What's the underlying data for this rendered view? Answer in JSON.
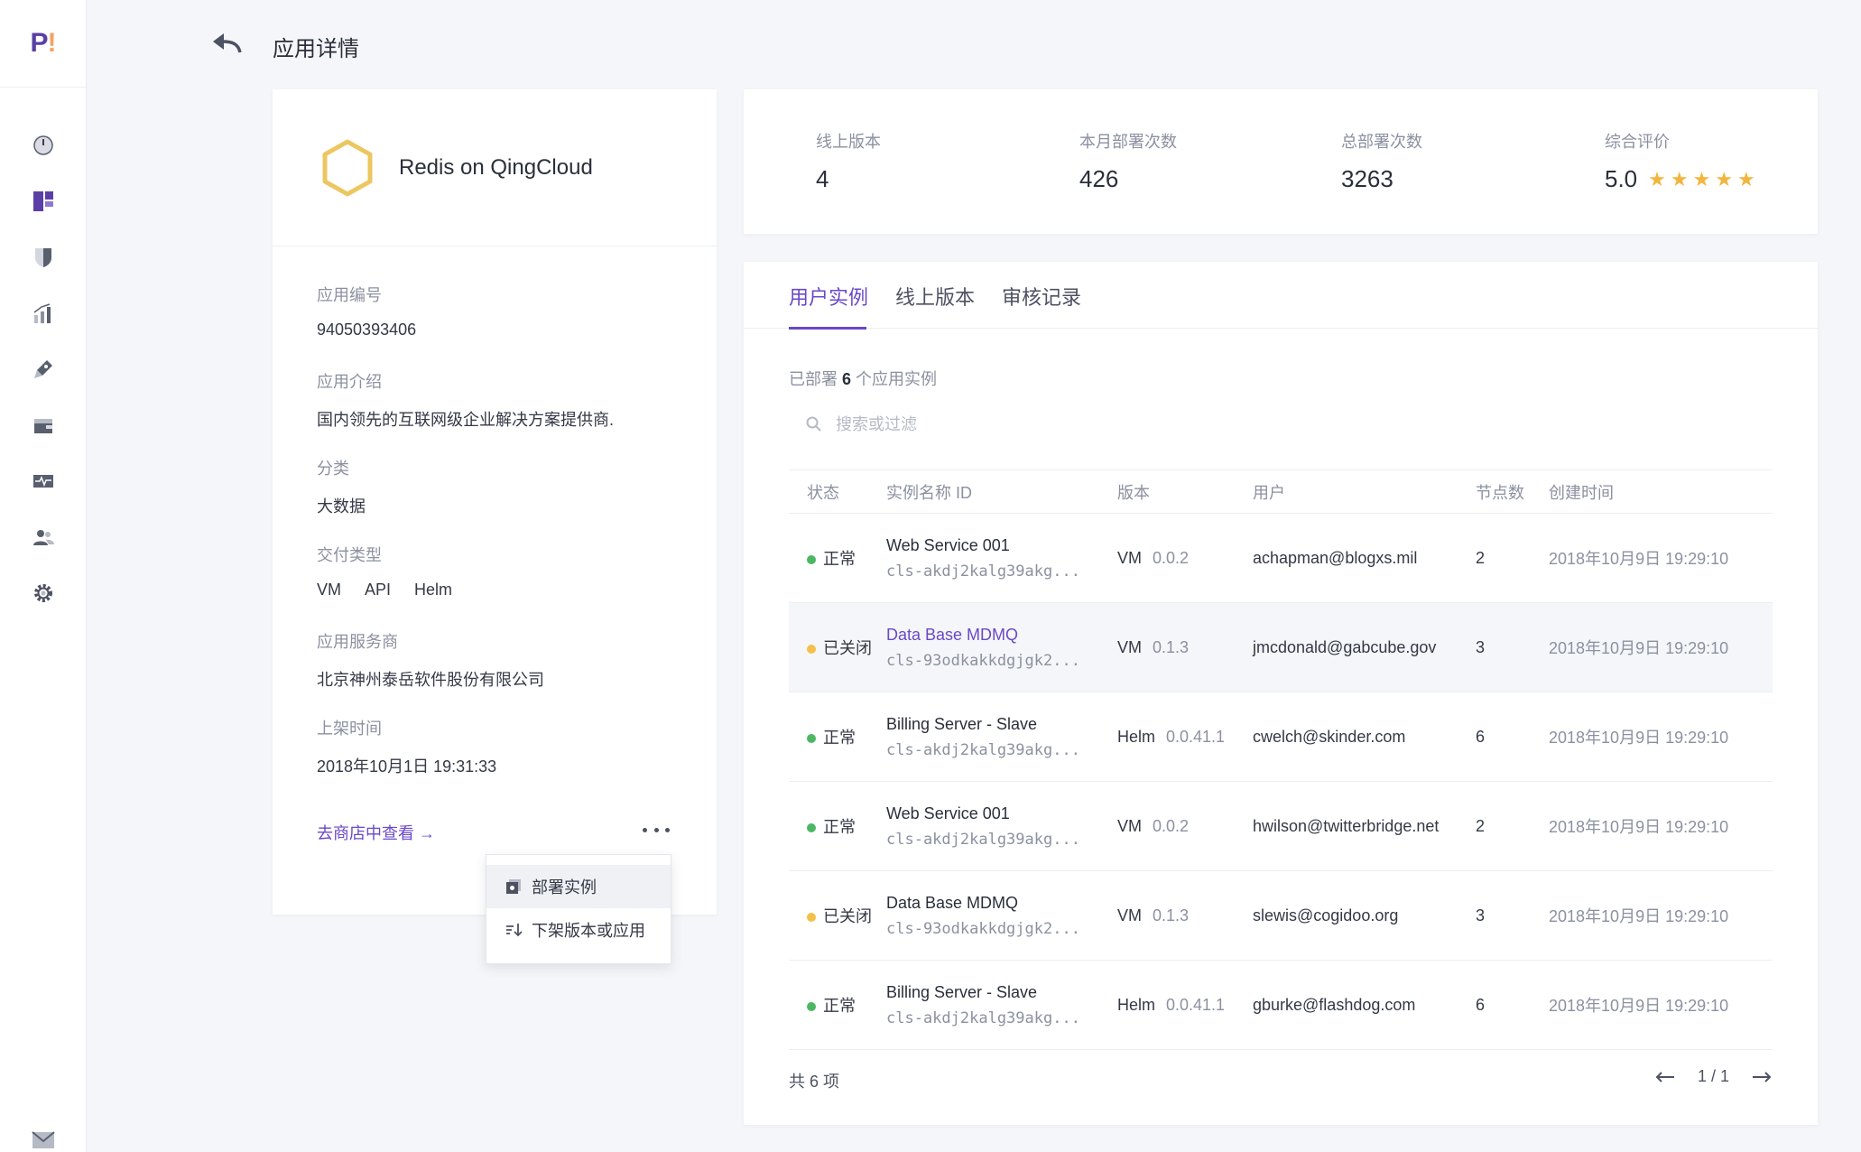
{
  "logo": {
    "text": "P",
    "mark": "!"
  },
  "nav": [
    "dashboard-icon",
    "apps-icon",
    "shield-icon",
    "chart-icon",
    "rocket-icon",
    "wallet-icon",
    "monitor-icon",
    "users-icon",
    "settings-icon"
  ],
  "header": {
    "title": "应用详情"
  },
  "app": {
    "name": "Redis on QingCloud",
    "fields": {
      "id_label": "应用编号",
      "id_value": "94050393406",
      "intro_label": "应用介绍",
      "intro_value": "国内领先的互联网级企业解决方案提供商.",
      "category_label": "分类",
      "category_value": "大数据",
      "delivery_label": "交付类型",
      "delivery_tags": [
        "VM",
        "API",
        "Helm"
      ],
      "vendor_label": "应用服务商",
      "vendor_value": "北京神州泰岳软件股份有限公司",
      "release_label": "上架时间",
      "release_value": "2018年10月1日 19:31:33"
    },
    "store_link": "去商店中查看 →"
  },
  "menu": {
    "deploy": "部署实例",
    "unpublish": "下架版本或应用"
  },
  "stats": {
    "online_label": "线上版本",
    "online_value": "4",
    "month_label": "本月部署次数",
    "month_value": "426",
    "total_label": "总部署次数",
    "total_value": "3263",
    "rating_label": "综合评价",
    "rating_value": "5.0",
    "stars": "★★★★★"
  },
  "tabs": [
    "用户实例",
    "线上版本",
    "审核记录"
  ],
  "summary": {
    "prefix": "已部署",
    "count": "6",
    "suffix": "个应用实例"
  },
  "search": {
    "placeholder": "搜索或过滤"
  },
  "colors": {
    "accent": "#6a48c7",
    "ok": "#4cb762",
    "closed": "#f5c04a"
  },
  "table": {
    "headers": [
      "状态",
      "实例名称 ID",
      "版本",
      "用户",
      "节点数",
      "创建时间"
    ],
    "rows": [
      {
        "status": "正常",
        "name": "Web Service 001",
        "id": "cls-akdj2kalg39akg...",
        "type": "VM",
        "version": "0.0.2",
        "user": "achapman@blogxs.mil",
        "nodes": "2",
        "time": "2018年10月9日 19:29:10"
      },
      {
        "status": "已关闭",
        "name": "Data Base MDMQ",
        "id": "cls-93odkakkdgjgk2...",
        "type": "VM",
        "version": "0.1.3",
        "user": "jmcdonald@gabcube.gov",
        "nodes": "3",
        "time": "2018年10月9日 19:29:10"
      },
      {
        "status": "正常",
        "name": "Billing Server - Slave",
        "id": "cls-akdj2kalg39akg...",
        "type": "Helm",
        "version": "0.0.41.1",
        "user": "cwelch@skinder.com",
        "nodes": "6",
        "time": "2018年10月9日 19:29:10"
      },
      {
        "status": "正常",
        "name": "Web Service 001",
        "id": "cls-akdj2kalg39akg...",
        "type": "VM",
        "version": "0.0.2",
        "user": "hwilson@twitterbridge.net",
        "nodes": "2",
        "time": "2018年10月9日 19:29:10"
      },
      {
        "status": "已关闭",
        "name": "Data Base MDMQ",
        "id": "cls-93odkakkdgjgk2...",
        "type": "VM",
        "version": "0.1.3",
        "user": "slewis@cogidoo.org",
        "nodes": "3",
        "time": "2018年10月9日 19:29:10"
      },
      {
        "status": "正常",
        "name": "Billing Server - Slave",
        "id": "cls-akdj2kalg39akg...",
        "type": "Helm",
        "version": "0.0.41.1",
        "user": "gburke@flashdog.com",
        "nodes": "6",
        "time": "2018年10月9日 19:29:10"
      }
    ]
  },
  "pagination": {
    "total": "共 6 项",
    "page": "1 / 1"
  }
}
